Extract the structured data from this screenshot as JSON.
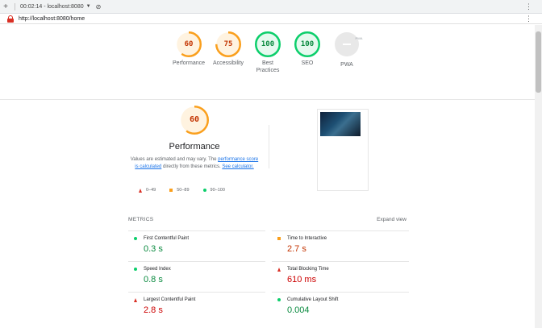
{
  "browser": {
    "new_tab_icon": "plus-icon",
    "tab_title": "00:02:14 - localhost:8080",
    "stop_icon": "stop-icon",
    "url": "http://localhost:8080/home",
    "menu_icon": "kebab-menu-icon"
  },
  "summary": {
    "gauges": [
      {
        "label": "Performance",
        "value": "60",
        "score": 60,
        "color": "#fa9f1c",
        "bg": "#fff3e0"
      },
      {
        "label": "Accessibility",
        "value": "75",
        "score": 75,
        "color": "#fa9f1c",
        "bg": "#fff3e0"
      },
      {
        "label": "Best Practices",
        "value": "100",
        "score": 100,
        "color": "#0cce6b",
        "bg": "#e6f9ef"
      },
      {
        "label": "SEO",
        "value": "100",
        "score": 100,
        "color": "#0cce6b",
        "bg": "#e6f9ef"
      }
    ],
    "pwa": {
      "label": "PWA",
      "badge": "PWA"
    }
  },
  "performance": {
    "score": "60",
    "score_fraction": 0.6,
    "color": "#fa9f1c",
    "title": "Performance",
    "desc_1": "Values are estimated and may vary. The ",
    "desc_link_1": "performance score is calculated",
    "desc_2": " directly from these metrics. ",
    "desc_link_2": "See calculator.",
    "legend": {
      "fail": "0–49",
      "average": "50–89",
      "pass": "90–100"
    }
  },
  "metrics": {
    "heading": "METRICS",
    "expand": "Expand view",
    "items": [
      {
        "label": "First Contentful Paint",
        "value": "0.3 s",
        "status": "pass"
      },
      {
        "label": "Time to Interactive",
        "value": "2.7 s",
        "status": "average"
      },
      {
        "label": "Speed Index",
        "value": "0.8 s",
        "status": "pass"
      },
      {
        "label": "Total Blocking Time",
        "value": "610 ms",
        "status": "fail"
      },
      {
        "label": "Largest Contentful Paint",
        "value": "2.8 s",
        "status": "fail"
      },
      {
        "label": "Cumulative Layout Shift",
        "value": "0.004",
        "status": "pass"
      }
    ]
  },
  "colors": {
    "pass": "#0cce6b",
    "pass_text": "#0a8a3f",
    "average": "#fa9f1c",
    "average_text": "#c33300",
    "fail": "#d93025",
    "fail_text": "#cc0000",
    "link": "#1a73e8"
  }
}
